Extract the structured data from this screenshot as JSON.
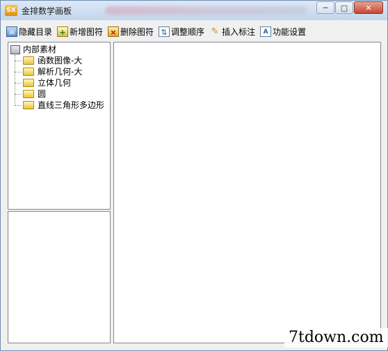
{
  "window": {
    "app_icon": "SX",
    "title": "金排数学画板",
    "controls": {
      "minimize_icon": "minimize-icon",
      "maximize_icon": "maximize-icon",
      "close_icon": "close-icon"
    }
  },
  "toolbar": {
    "items": [
      {
        "label": "隐藏目录",
        "icon": "hide-tree-icon"
      },
      {
        "label": "新增图符",
        "icon": "add-symbol-icon"
      },
      {
        "label": "删除图符",
        "icon": "delete-symbol-icon"
      },
      {
        "label": "调整顺序",
        "icon": "reorder-icon"
      },
      {
        "label": "插入标注",
        "icon": "pencil-icon"
      },
      {
        "label": "功能设置",
        "icon": "settings-icon"
      }
    ]
  },
  "tree": {
    "root": {
      "label": "内部素材",
      "icon": "computer-icon"
    },
    "children": [
      {
        "label": "函数图像-大",
        "icon": "folder-icon"
      },
      {
        "label": "解析几何-大",
        "icon": "folder-icon"
      },
      {
        "label": "立体几何",
        "icon": "folder-icon"
      },
      {
        "label": "圆",
        "icon": "folder-icon"
      },
      {
        "label": "直线三角形多边形",
        "icon": "folder-icon"
      }
    ]
  },
  "watermark": {
    "text": "7tdown.com"
  }
}
